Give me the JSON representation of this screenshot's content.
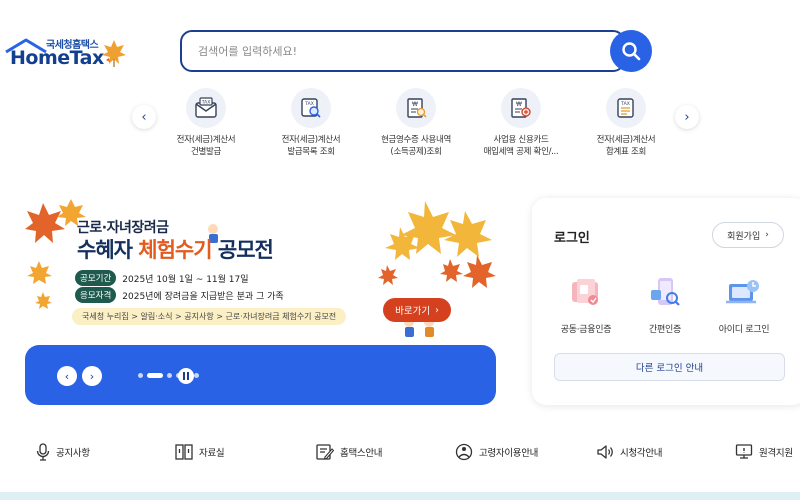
{
  "header": {
    "logo_sub": "국세청홈택스",
    "logo_main": "HomeTax",
    "search_placeholder": "검색어를 입력하세요!"
  },
  "quick_menu": {
    "items": [
      {
        "label": "전자(세금)계산서\n건별발급",
        "icon": "tax-envelope-icon"
      },
      {
        "label": "전자(세금)계산서\n발급목록 조회",
        "icon": "tax-search-icon"
      },
      {
        "label": "현금영수증 사용내역\n(소득공제)조회",
        "icon": "receipt-search-icon"
      },
      {
        "label": "사업용 신용카드\n매입세액 공제 확인/...",
        "icon": "card-receipt-icon"
      },
      {
        "label": "전자(세금)계산서\n합계표 조회",
        "icon": "tax-summary-icon"
      }
    ]
  },
  "banner": {
    "eyebrow": "근로·자녀장려금",
    "title_a": "수혜자 ",
    "title_b": "체험수기",
    "title_c": " 공모전",
    "period_tag": "공모기간",
    "period_text": "2025년 10월 1일 ~ 11월 17일",
    "qual_tag": "응모자격",
    "qual_text": "2025년에 장려금을 지급받은 분과 그 가족",
    "path": "국세청 누리집 > 알림·소식 > 공지사항 > 근로·자녀장려금 체험수기 공모전",
    "go_label": "바로가기",
    "slide_count": 6,
    "active_slide": 1
  },
  "login": {
    "title": "로그인",
    "join_label": "회원가입",
    "options": [
      {
        "label": "공동·금융인증",
        "icon": "certificate-icon"
      },
      {
        "label": "간편인증",
        "icon": "phone-auth-icon"
      },
      {
        "label": "아이디 로그인",
        "icon": "id-login-icon"
      }
    ],
    "other_label": "다른 로그인 안내"
  },
  "footer_links": [
    {
      "label": "공지사항",
      "icon": "microphone-icon"
    },
    {
      "label": "자료실",
      "icon": "archive-icon"
    },
    {
      "label": "홈택스안내",
      "icon": "guide-icon"
    },
    {
      "label": "고령자이용안내",
      "icon": "senior-icon"
    },
    {
      "label": "시청각안내",
      "icon": "speaker-icon"
    },
    {
      "label": "원격지원",
      "icon": "remote-support-icon"
    }
  ],
  "colors": {
    "primary": "#2a62e6",
    "navy": "#1e3f8f",
    "accent": "#e35b1e"
  }
}
